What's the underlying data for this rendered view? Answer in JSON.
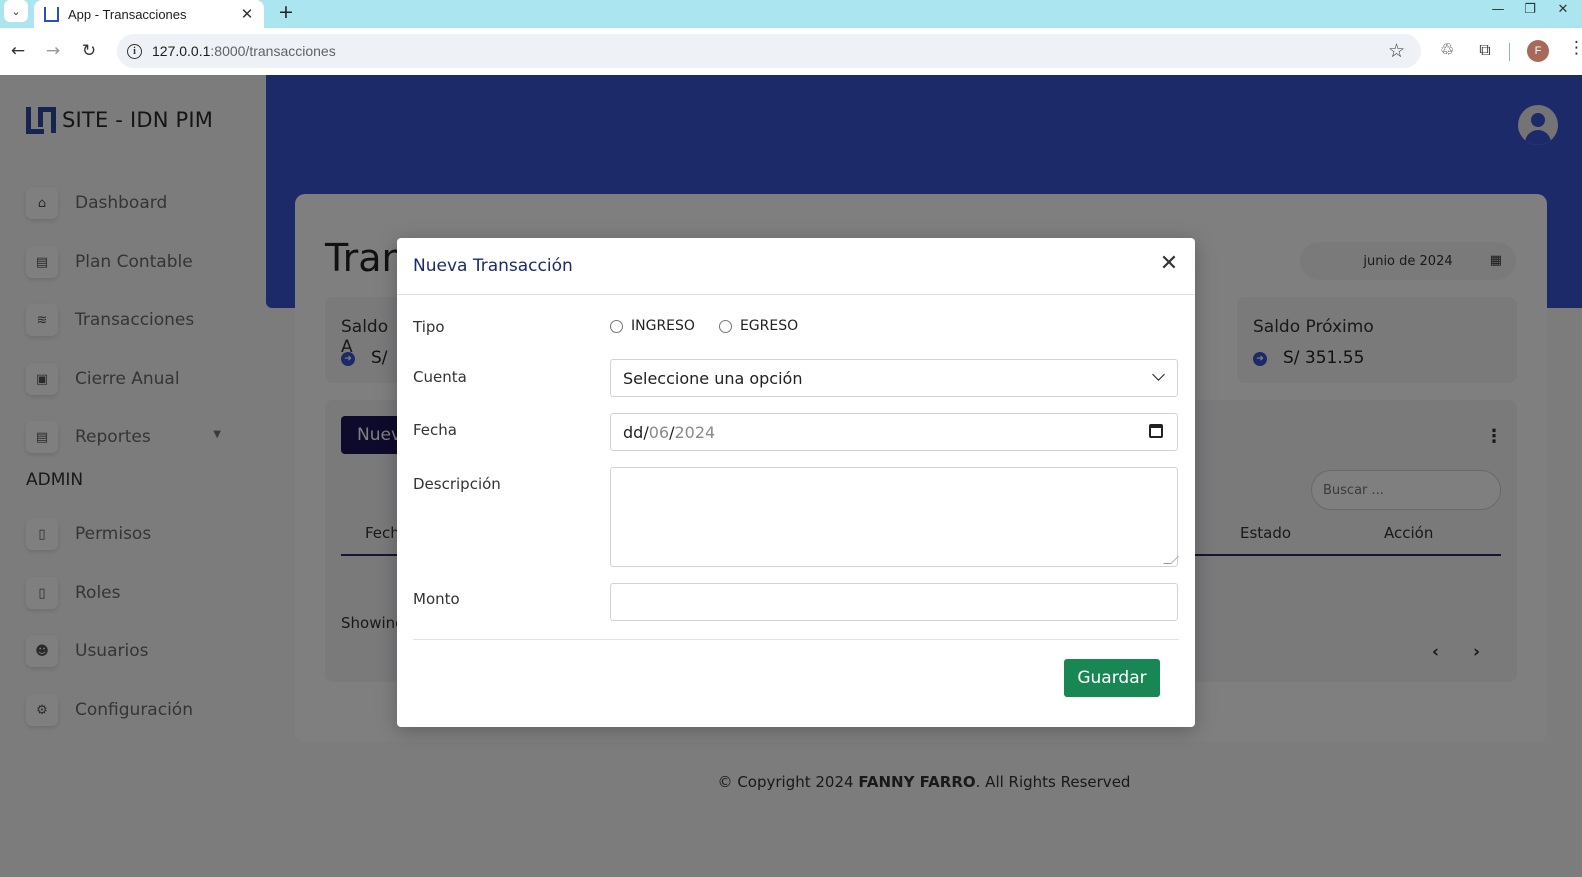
{
  "browser": {
    "tab_title": "App - Transacciones",
    "url_host": "127.0.0.1",
    "url_path": ":8000/transacciones",
    "profile_initial": "F"
  },
  "sidebar": {
    "brand": "SITE - IDN PIM",
    "items": [
      {
        "label": "Dashboard",
        "icon": "home-icon"
      },
      {
        "label": "Plan Contable",
        "icon": "document-icon"
      },
      {
        "label": "Transacciones",
        "icon": "coins-icon"
      },
      {
        "label": "Cierre Anual",
        "icon": "lock-icon"
      },
      {
        "label": "Reportes",
        "icon": "document-icon"
      }
    ],
    "admin_section": "ADMIN",
    "admin_items": [
      {
        "label": "Permisos",
        "icon": "file-icon"
      },
      {
        "label": "Roles",
        "icon": "file-icon"
      },
      {
        "label": "Usuarios",
        "icon": "users-icon"
      },
      {
        "label": "Configuración",
        "icon": "gear-icon"
      }
    ]
  },
  "main": {
    "title": "Tran",
    "month": "junio de 2024",
    "stats": [
      {
        "label": "Saldo A",
        "value": "S/ "
      },
      {
        "label": "Saldo Próximo",
        "value": "S/ 351.55"
      }
    ],
    "new_button": "Nuev",
    "search_placeholder": "Buscar ...",
    "columns": {
      "first": "Fech",
      "estado": "Estado",
      "accion": "Acción"
    },
    "showing": "Showing"
  },
  "footer": {
    "prefix": "© Copyright 2024 ",
    "owner": "FANNY FARRO",
    "suffix": ". All Rights Reserved"
  },
  "modal": {
    "title": "Nueva Transacción",
    "tipo_label": "Tipo",
    "tipo_options": [
      "INGRESO",
      "EGRESO"
    ],
    "cuenta_label": "Cuenta",
    "cuenta_value": "Seleccione una opción",
    "fecha_label": "Fecha",
    "fecha_day": "dd",
    "fecha_month": "06",
    "fecha_year": "2024",
    "descripcion_label": "Descripción",
    "monto_label": "Monto",
    "save_label": "Guardar"
  },
  "colors": {
    "header_blue": "#3a55d4",
    "primary_dark": "#1c1457",
    "success": "#198754"
  }
}
